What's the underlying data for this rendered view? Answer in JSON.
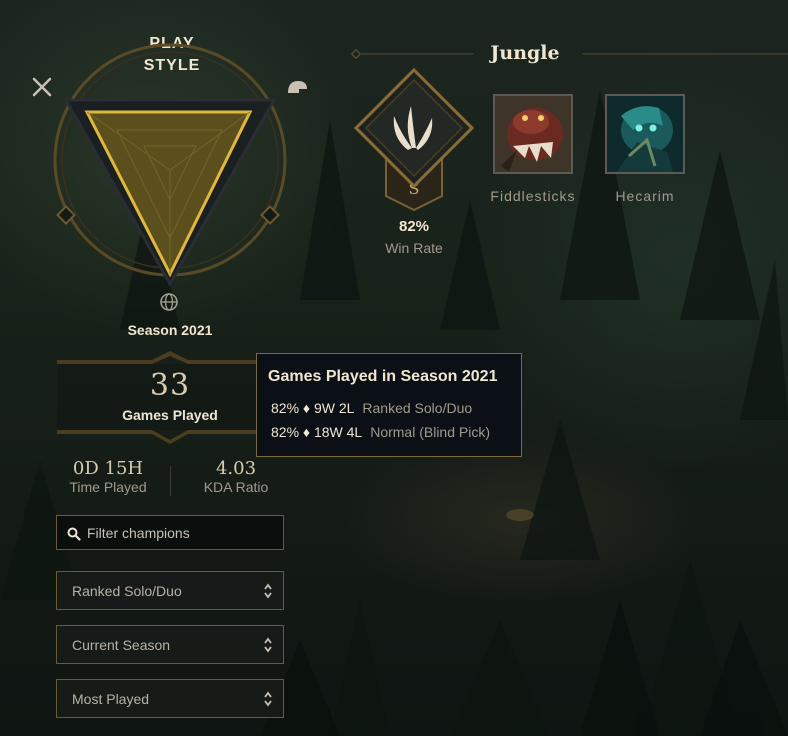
{
  "play_style": {
    "title_line1": "PLAY",
    "title_line2": "STYLE",
    "left_icon": "crossed-swords-icon",
    "right_icon": "helmet-icon",
    "bottom_icon": "globe-icon"
  },
  "season": {
    "label": "Season 2021"
  },
  "games_played": {
    "count": "33",
    "label": "Games Played"
  },
  "stats": [
    {
      "value": "0D 15H",
      "label": "Time Played"
    },
    {
      "value": "4.03",
      "label": "KDA Ratio"
    }
  ],
  "filters": {
    "search_placeholder": "Filter champions",
    "queue": "Ranked Solo/Duo",
    "season": "Current Season",
    "sort": "Most Played"
  },
  "tooltip": {
    "title": "Games Played in Season 2021",
    "rows": [
      {
        "stats": "82% ♦ 9W 2L",
        "queue": "Ranked Solo/Duo"
      },
      {
        "stats": "82% ♦ 18W 4L",
        "queue": "Normal (Blind Pick)"
      }
    ]
  },
  "role": {
    "title": "Jungle",
    "rank_letter": "S",
    "win_rate_value": "82%",
    "win_rate_label": "Win Rate",
    "icon": "jungle-claw-icon"
  },
  "champions": [
    {
      "name": "Fiddlesticks"
    },
    {
      "name": "Hecarim"
    }
  ],
  "colors": {
    "gold": "#c8aa6e",
    "gold_dark": "#785a28",
    "text_light": "#f0e6d2",
    "text_muted": "#a09b8c",
    "tooltip_bg": "#0b1016"
  }
}
